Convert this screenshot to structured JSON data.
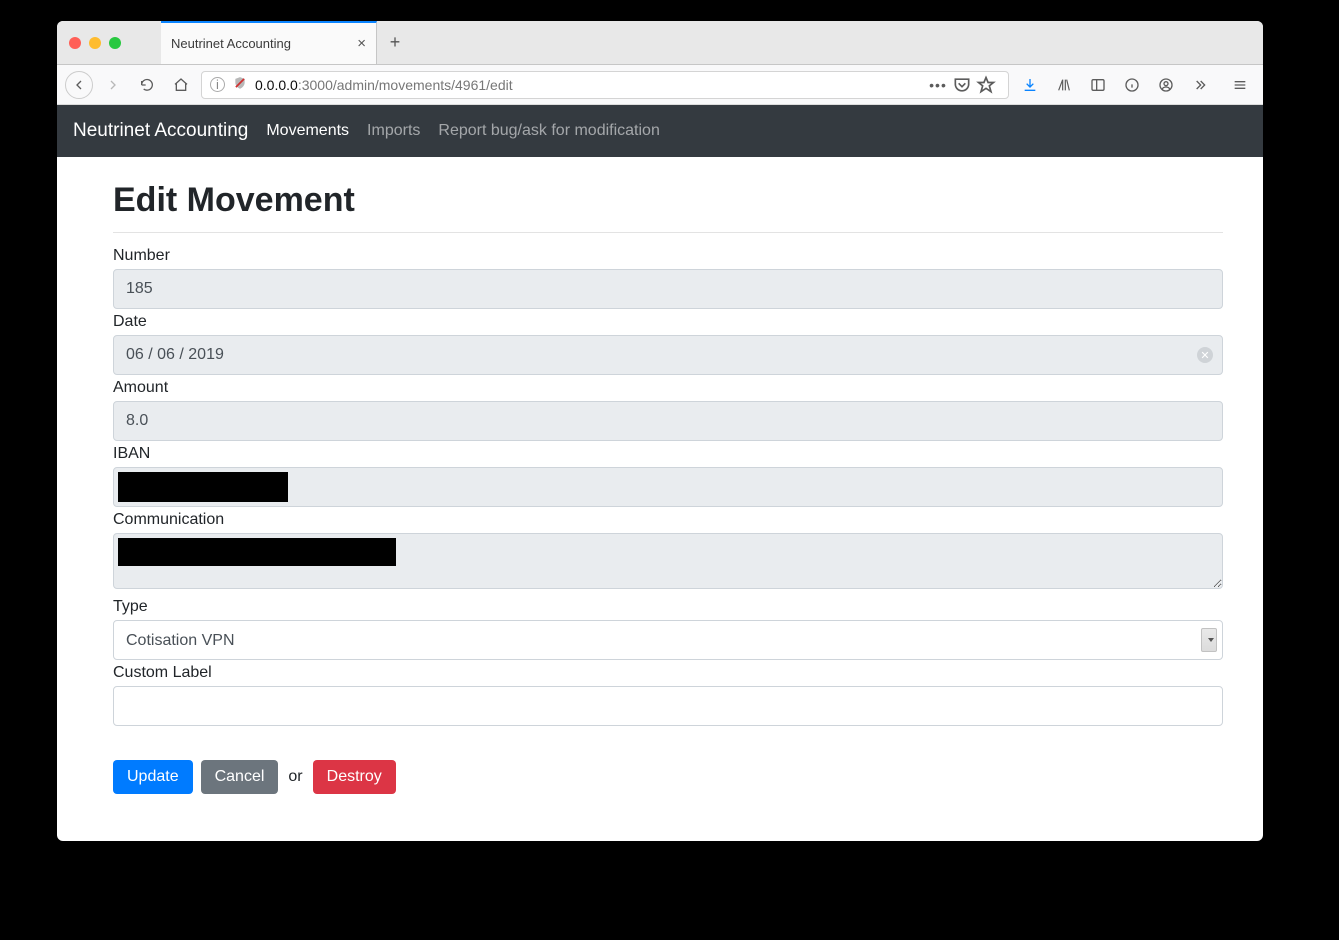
{
  "window": {
    "tab_title": "Neutrinet Accounting"
  },
  "browser": {
    "url_host": "0.0.0.0",
    "url_port_path": ":3000/admin/movements/4961/edit"
  },
  "navbar": {
    "brand": "Neutrinet Accounting",
    "links": [
      "Movements",
      "Imports",
      "Report bug/ask for modification"
    ],
    "active_index": 0
  },
  "page": {
    "title": "Edit Movement"
  },
  "form": {
    "number": {
      "label": "Number",
      "value": "185"
    },
    "date": {
      "label": "Date",
      "value": "06 / 06 / 2019"
    },
    "amount": {
      "label": "Amount",
      "value": "8.0"
    },
    "iban": {
      "label": "IBAN",
      "value": ""
    },
    "communication": {
      "label": "Communication",
      "value": ""
    },
    "type": {
      "label": "Type",
      "selected": "Cotisation VPN"
    },
    "custom_label": {
      "label": "Custom Label",
      "value": ""
    }
  },
  "actions": {
    "update": "Update",
    "cancel": "Cancel",
    "or": "or",
    "destroy": "Destroy"
  }
}
